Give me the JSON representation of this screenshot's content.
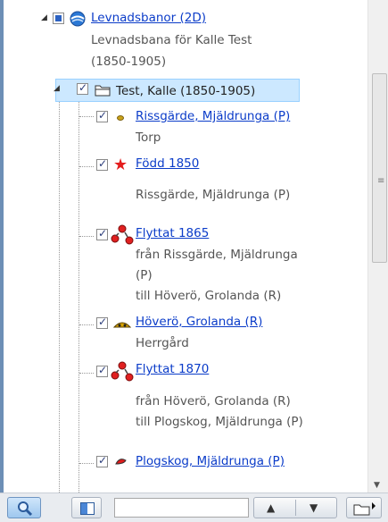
{
  "tree": {
    "root": {
      "label": "Levnadsbanor (2D)",
      "desc_line1": "Levnadsbana för Kalle Test",
      "desc_line2": "(1850-1905)"
    },
    "folder": {
      "label": "Test, Kalle (1850-1905)"
    },
    "items": [
      {
        "label": "Rissgärde, Mjäldrunga (P)",
        "lines": [
          "Torp"
        ],
        "icon": "small-dot-icon"
      },
      {
        "label": "Född 1850",
        "lines": [
          "",
          "Rissgärde, Mjäldrunga (P)"
        ],
        "icon": "red-star-icon"
      },
      {
        "label": "Flyttat 1865",
        "lines": [
          "från Rissgärde, Mjäldrunga",
          "(P)",
          "till Höverö, Grolanda (R)"
        ],
        "icon": "move-arrows-icon"
      },
      {
        "label": "Höverö, Grolanda (R)",
        "lines": [
          "Herrgård"
        ],
        "icon": "manor-icon"
      },
      {
        "label": "Flyttat 1870",
        "lines": [
          "",
          "från Höverö, Grolanda (R)",
          "till Plogskog, Mjäldrunga (P)"
        ],
        "icon": "move-arrows-icon"
      },
      {
        "label": "Plogskog, Mjäldrunga (P)",
        "lines": [],
        "icon": "red-dot-icon"
      }
    ]
  },
  "toolbar": {
    "search_placeholder": ""
  },
  "colors": {
    "link": "#0b3cc9",
    "selection": "#cce8ff",
    "edge": "#6d8fb6"
  }
}
